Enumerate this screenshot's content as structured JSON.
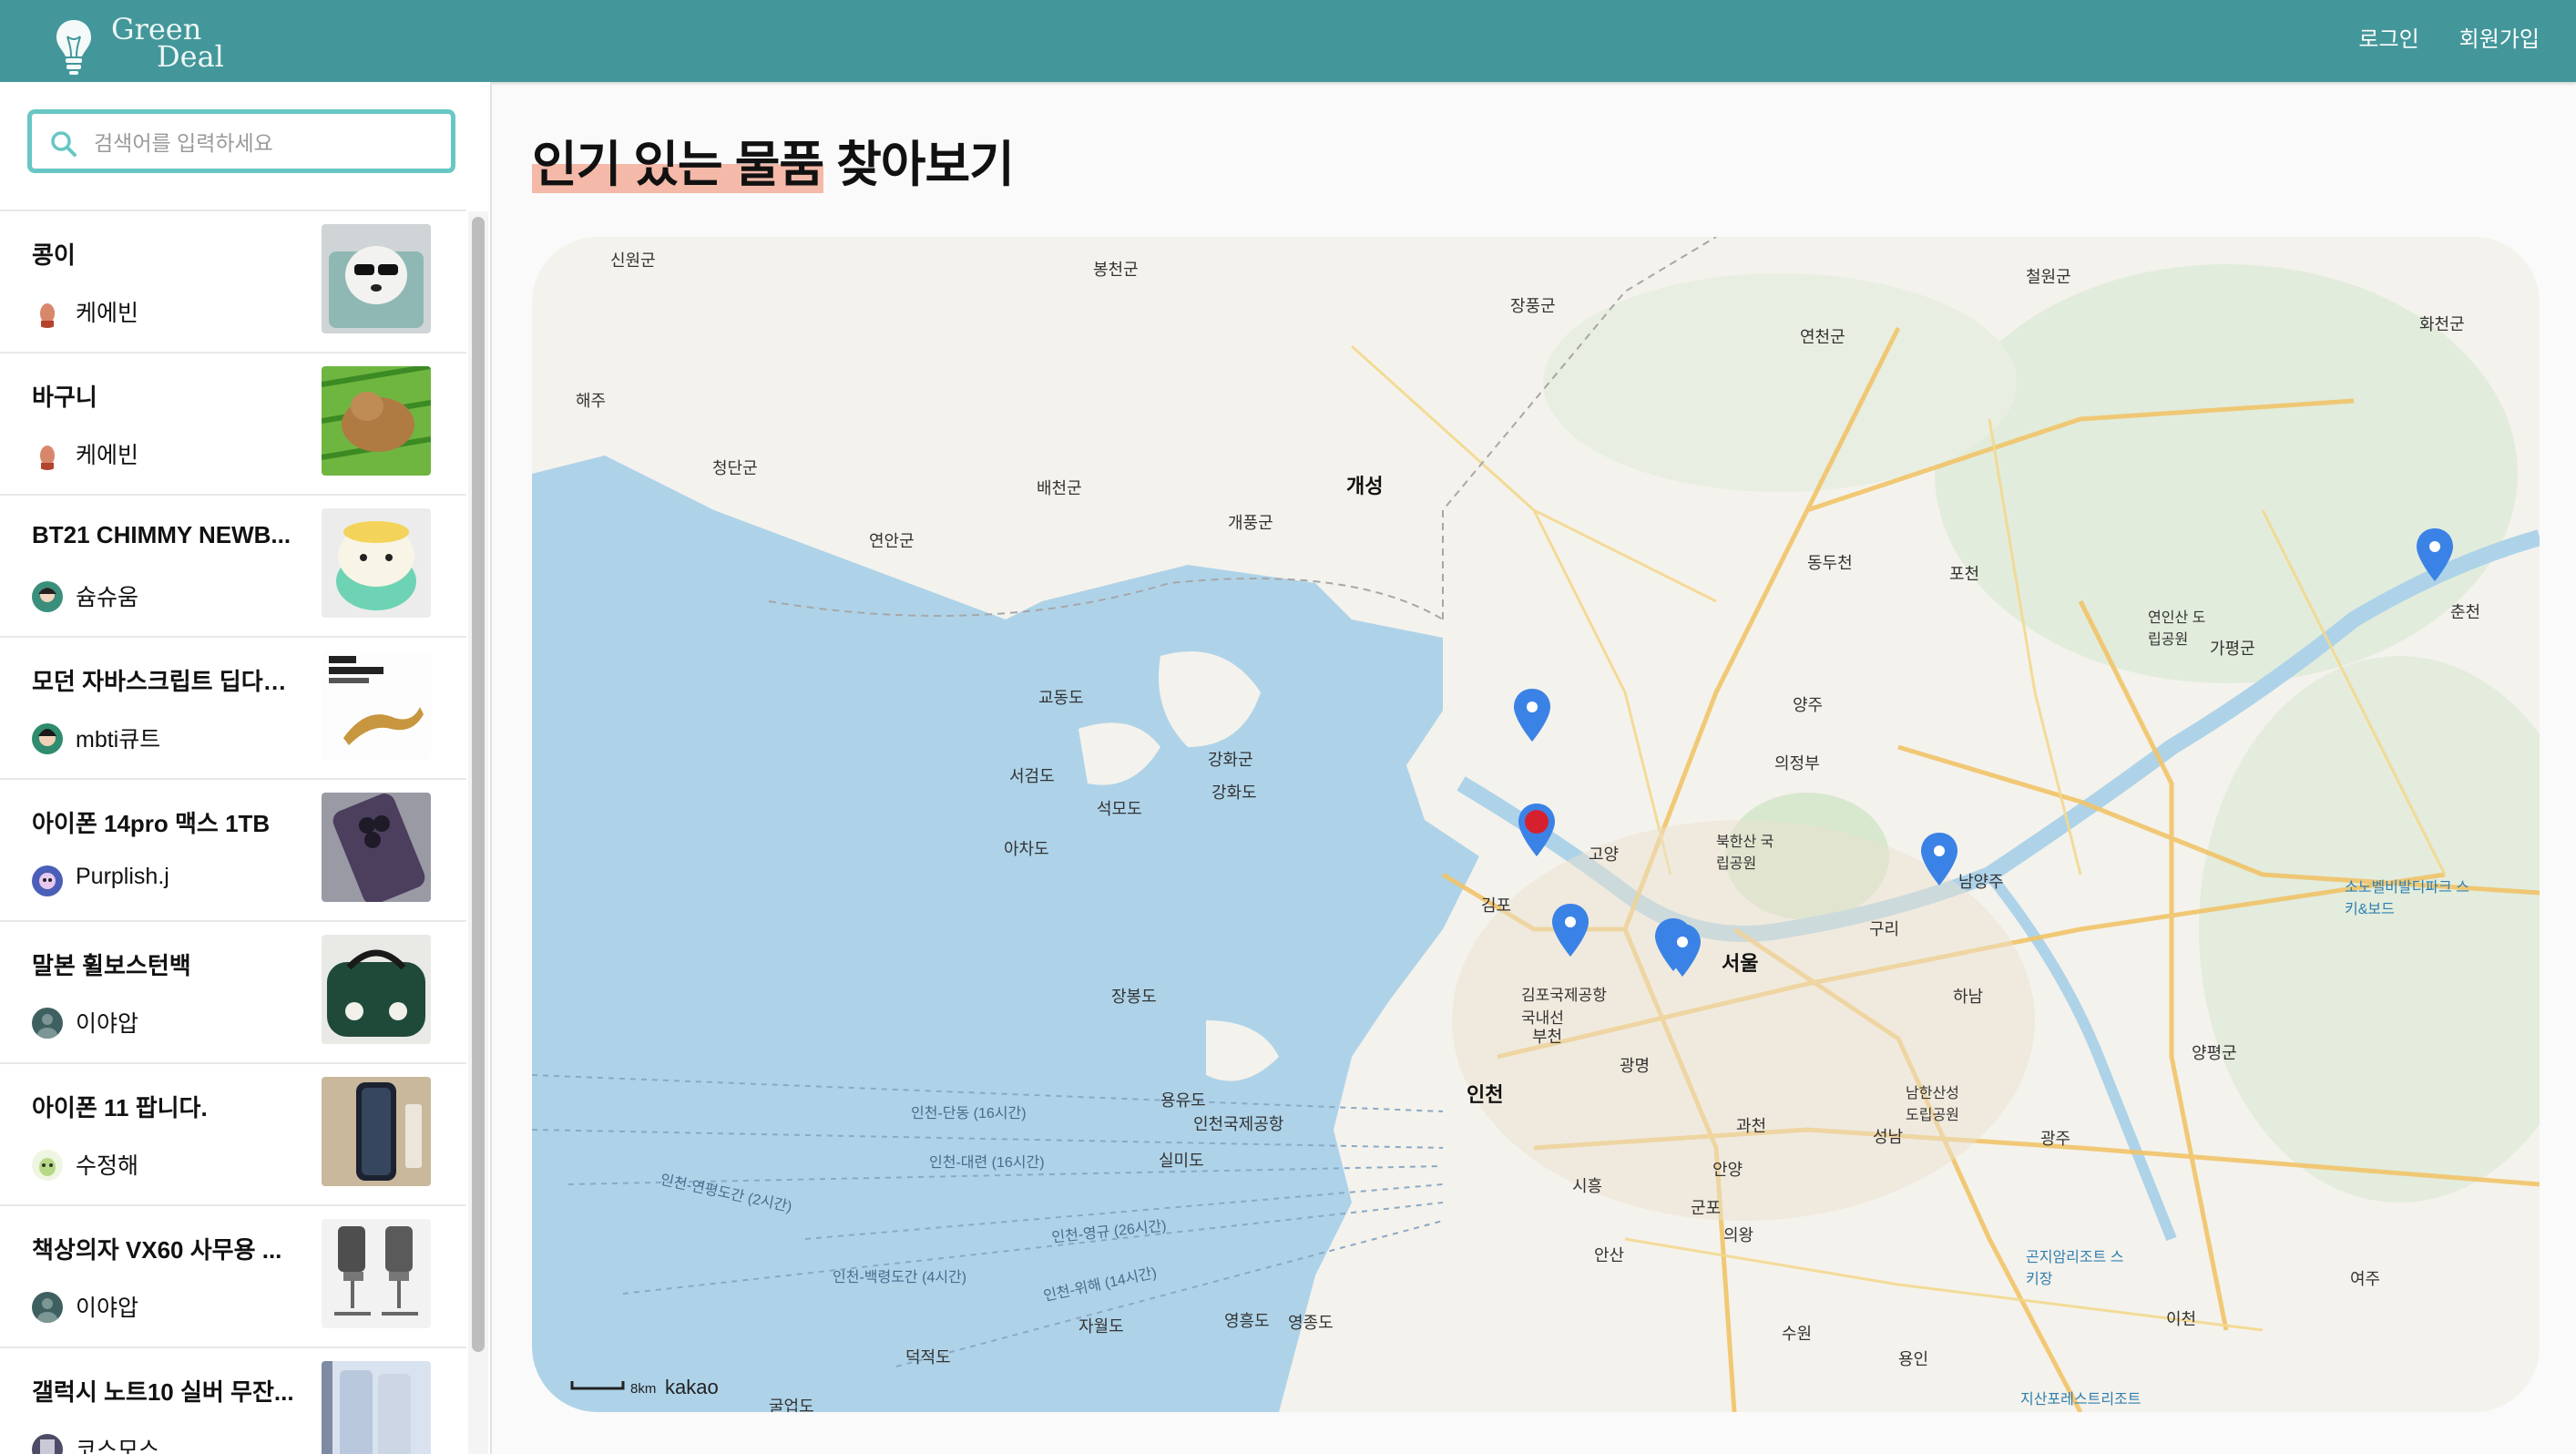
{
  "header": {
    "brand_line1": "Green",
    "brand_line2": "Deal",
    "login": "로그인",
    "signup": "회원가입"
  },
  "sidebar": {
    "search_placeholder": "검색어를 입력하세요",
    "items": [
      {
        "title": "콩이",
        "user": "케에빈"
      },
      {
        "title": "바구니",
        "user": "케에빈"
      },
      {
        "title": "BT21 CHIMMY NEWB...",
        "user": "슘슈움"
      },
      {
        "title": "모던 자바스크립트 딥다이...",
        "user": "mbti큐트"
      },
      {
        "title": "아이폰 14pro 맥스 1TB",
        "user": "Purplish.j"
      },
      {
        "title": "말본 휠보스턴백",
        "user": "이야압"
      },
      {
        "title": "아이폰 11 팝니다.",
        "user": "수정해"
      },
      {
        "title": "책상의자 VX60 사무용 ...",
        "user": "이야압"
      },
      {
        "title": "갤럭시 노트10 실버 무잔...",
        "user": "코스모스"
      }
    ]
  },
  "main": {
    "heading_highlight": "인기 있는 물품",
    "heading_rest": "찾아보기"
  },
  "map": {
    "places": [
      "신원군",
      "봉천군",
      "장풍군",
      "철원군",
      "연천군",
      "화천군",
      "해주",
      "청단군",
      "배천군",
      "개성",
      "연안군",
      "개풍군",
      "동두천",
      "포천",
      "춘천",
      "가평군",
      "교동도",
      "강화군",
      "양주",
      "강화도",
      "의정부",
      "서검도",
      "석모도",
      "아차도",
      "고양",
      "김포",
      "남양주",
      "구리",
      "서울",
      "하남",
      "인천",
      "부천",
      "광명",
      "과천",
      "성남",
      "안양",
      "시흥",
      "광주",
      "군포",
      "의왕",
      "안산",
      "수원",
      "용인",
      "이천",
      "여주",
      "양평군",
      "영종도",
      "용유도",
      "인천국제공항",
      "실미도",
      "장봉도",
      "자월도",
      "영흥도",
      "덕적도",
      "굴업도",
      "김포국제공항 국내선",
      "북한산 국립공원",
      "연인산 도립공원",
      "남한산성 도립공원",
      "소노벨비발디파크 스키&보드",
      "곤지암리조트 스키장",
      "지산포레스트리조트",
      "인천-단동 (16시간)",
      "인천-대련 (16시간)",
      "인천-연평도간 (2시간)",
      "인천-영규 (26시간)",
      "인천-백령도간 (4시간)",
      "인천-위해 (14시간)"
    ],
    "scale_label": "8km",
    "attribution": "kakao"
  },
  "colors": {
    "header": "#43979a",
    "search_border": "#68c7c4",
    "heading_highlight": "#f4b9a8",
    "water": "#aed3e9",
    "pin_blue": "#3b82e6",
    "pin_red": "#d6202e"
  }
}
